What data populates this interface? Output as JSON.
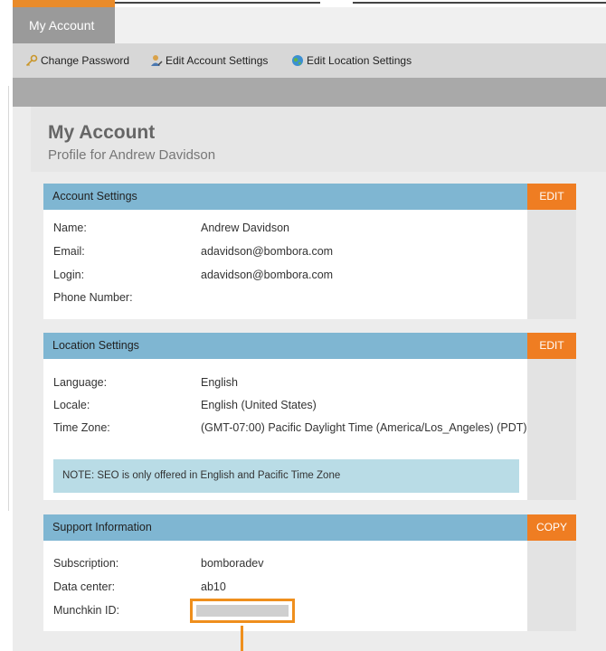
{
  "tab": {
    "label": "My Account"
  },
  "toolbar": {
    "change_password": "Change Password",
    "edit_account_settings": "Edit Account Settings",
    "edit_location_settings": "Edit Location Settings"
  },
  "page": {
    "title": "My Account",
    "subtitle": "Profile for Andrew Davidson"
  },
  "account_settings": {
    "header": "Account Settings",
    "action": "EDIT",
    "fields": [
      {
        "label": "Name:",
        "value": "Andrew Davidson"
      },
      {
        "label": "Email:",
        "value": "adavidson@bombora.com"
      },
      {
        "label": "Login:",
        "value": "adavidson@bombora.com"
      },
      {
        "label": "Phone Number:",
        "value": ""
      }
    ]
  },
  "location_settings": {
    "header": "Location Settings",
    "action": "EDIT",
    "fields": [
      {
        "label": "Language:",
        "value": "English"
      },
      {
        "label": "Locale:",
        "value": "English (United States)"
      },
      {
        "label": "Time Zone:",
        "value": "(GMT-07:00) Pacific Daylight Time (America/Los_Angeles) (PDT)"
      }
    ],
    "note": "NOTE: SEO is only offered in English and Pacific Time Zone"
  },
  "support_information": {
    "header": "Support Information",
    "action": "COPY",
    "fields": [
      {
        "label": "Subscription:",
        "value": "bomboradev"
      },
      {
        "label": "Data center:",
        "value": "ab10"
      },
      {
        "label": "Munchkin ID:",
        "value": ""
      }
    ]
  },
  "colors": {
    "accent": "#ef7d22",
    "section_header": "#7fb6d2",
    "note_bg": "#b9dce6"
  },
  "icons": {
    "change_password": "key-icon",
    "edit_account": "person-edit-icon",
    "edit_location": "globe-icon"
  }
}
